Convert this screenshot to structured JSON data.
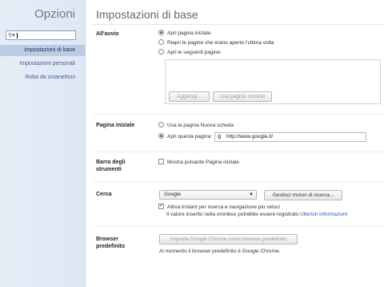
{
  "sidebar": {
    "title": "Opzioni",
    "search": {
      "value": ""
    },
    "items": [
      {
        "label": "Impostazioni di base",
        "active": true
      },
      {
        "label": "Impostazioni personali",
        "active": false
      },
      {
        "label": "Roba da smanettoni",
        "active": false
      }
    ]
  },
  "main": {
    "title": "Impostazioni di base",
    "startup": {
      "label": "All'avvio",
      "options": [
        "Apri pagina iniziale",
        "Riapri le pagine che erano aperte l'ultima volta",
        "Apri le seguenti pagine:"
      ],
      "add_button": "Aggiungi...",
      "current_pages_button": "Usa pagine correnti"
    },
    "home_page": {
      "label": "Pagina iniziale",
      "new_tab_option": "Usa la pagina Nuova scheda",
      "open_page_option": "Apri questa pagina:",
      "url": "http://www.google.it/"
    },
    "toolbar": {
      "label_line1": "Barra degli",
      "label_line2": "strumenti",
      "show_home_button": "Mostra pulsante Pagina iniziale"
    },
    "search": {
      "label": "Cerca",
      "engine": "Google",
      "manage_button": "Gestisci motori di ricerca...",
      "instant_label": "Attiva Instant per ricerca e navigazione più veloci",
      "instant_note": "Il valore inserito nella omnibox potrebbe essere registrato",
      "more_info_link": "Ulteriori informazioni"
    },
    "default_browser": {
      "label_line1": "Browser",
      "label_line2": "predefinito",
      "button": "Imposta Google Chrome come browser predefinito",
      "status": "Al momento il browser predefinito è Google Chrome."
    }
  }
}
